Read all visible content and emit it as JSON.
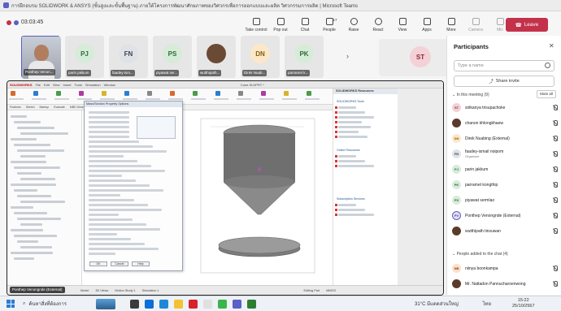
{
  "window": {
    "title": "การฝึกอบรม SOLIDWORK & ANSYS (ขั้นสูงและขั้นพื้นฐาน) ภายใต้โครงการพัฒนาศักยภาพของวิศวกรเพื่อการออกแบบและผลิต วิศวกรรมการผลิต | Microsoft Teams"
  },
  "meeting": {
    "timer": "03:03:45",
    "toolbar": [
      {
        "label": "Take control",
        "icon": "take-control-icon"
      },
      {
        "label": "Pop out",
        "icon": "pop-out-icon"
      },
      {
        "label": "Chat",
        "icon": "chat-icon"
      },
      {
        "label": "People",
        "icon": "people-icon",
        "count": "17"
      },
      {
        "label": "Raise",
        "icon": "raise-hand-icon"
      },
      {
        "label": "React",
        "icon": "react-icon"
      },
      {
        "label": "View",
        "icon": "view-icon"
      },
      {
        "label": "Apps",
        "icon": "apps-icon"
      },
      {
        "label": "More",
        "icon": "more-icon"
      },
      {
        "label": "Camera",
        "icon": "camera-off-icon"
      },
      {
        "label": "Mic",
        "icon": "mic-off-icon"
      },
      {
        "label": "Share",
        "icon": "share-icon"
      }
    ],
    "leave_label": "Leave",
    "colors": {
      "accent": "#5b5fc7",
      "leave": "#c4314b"
    }
  },
  "strip": {
    "tiles": [
      {
        "name": "Ponthep Venon...",
        "initials": "",
        "video": true
      },
      {
        "name": "parin jakkum",
        "initials": "PJ",
        "bg": "#d6ecd9",
        "fg": "#2e6b39"
      },
      {
        "name": "faadey-ism...",
        "initials": "FN",
        "bg": "#dfe3e8",
        "fg": "#3a4552"
      },
      {
        "name": "piyawat ser...",
        "initials": "PS",
        "bg": "#d6ecd9",
        "fg": "#2e6b39"
      },
      {
        "name": "wutthipath...",
        "initials": "",
        "photo": true
      },
      {
        "name": "Direk Nuab...",
        "initials": "DN",
        "bg": "#fbe8c8",
        "fg": "#8a5a10"
      },
      {
        "name": "parramet k...",
        "initials": "PK",
        "bg": "#d6ecd9",
        "fg": "#2e6b39"
      }
    ],
    "stage": {
      "initials": "ST"
    }
  },
  "shared_screen": {
    "presenter": "Ponthep Venongnde (External)",
    "sw": {
      "brand": "SOLIDWORKS",
      "menus": [
        "File",
        "Edit",
        "View",
        "Insert",
        "Tools",
        "Simulation",
        "Window"
      ],
      "doc_title": "Cone.SLDPRT *",
      "tabs": [
        "Features",
        "Sketch",
        "Markup",
        "Evaluate",
        "MBD Dimensions",
        "SOLIDWORKS Add-Ins",
        "Simulation",
        "MBD"
      ],
      "dialog_title": "Mass/Section Property Options",
      "dialog_buttons": [
        "OK",
        "Cancel",
        "Help"
      ],
      "resources_title": "SOLIDWORKS Resources",
      "resources_sections": [
        "SOLIDWORKS Tools",
        "Online Resources",
        "Subscription Services"
      ],
      "bottom_tabs": [
        "Model",
        "3D Views",
        "Motion Study 1",
        "Simulation 1"
      ],
      "status": [
        "Editing Part",
        "MMGS"
      ]
    }
  },
  "participants": {
    "title": "Participants",
    "search_placeholder": "Type a name",
    "share_invite": "Share invite",
    "in_meeting_label": "In this meeting (9)",
    "mute_all": "Mute all",
    "people": [
      {
        "name": "sirikanya trisupachoke",
        "initials": "ST",
        "bg": "#f3d1d6",
        "fg": "#8d2a3a"
      },
      {
        "name": "chanon khlongkhaew",
        "initials": "",
        "photo": true
      },
      {
        "name": "Direk Nuabing (External)",
        "initials": "DN",
        "bg": "#fbe8c8",
        "fg": "#8a5a10"
      },
      {
        "name": "faadey-ismail noipom",
        "sub": "Organizer",
        "initials": "FN",
        "bg": "#dfe3e8",
        "fg": "#3a4552"
      },
      {
        "name": "parin jakkum",
        "initials": "PJ",
        "bg": "#d6ecd9",
        "fg": "#2e6b39"
      },
      {
        "name": "parramet kongthip",
        "initials": "PK",
        "bg": "#d6ecd9",
        "fg": "#2e6b39"
      },
      {
        "name": "piyawat sermlao",
        "initials": "PS",
        "bg": "#d6ecd9",
        "fg": "#2e6b39"
      },
      {
        "name": "Ponthep Venongnde (External)",
        "initials": "PV",
        "bg": "#e6dcf2",
        "fg": "#5b3b8a",
        "active": true
      },
      {
        "name": "wutthipath tinsuwan",
        "initials": "",
        "photo": true
      }
    ],
    "chat_section_label": "People added to the chat (4)",
    "chat_people": [
      {
        "name": "niinya boonkampa",
        "initials": "NB",
        "bg": "#fbe0cc",
        "fg": "#8a4010"
      },
      {
        "name": "Mr. Nattadon Pannucharoenwong",
        "initials": "",
        "photo": true
      }
    ]
  },
  "taskbar": {
    "search": "ค้นหาสิ่งที่ต้องการ",
    "weather": "31°C มีแดดส่วนใหญ่",
    "lang": "ไทย",
    "time": "15:22",
    "date": "25/10/2567"
  }
}
